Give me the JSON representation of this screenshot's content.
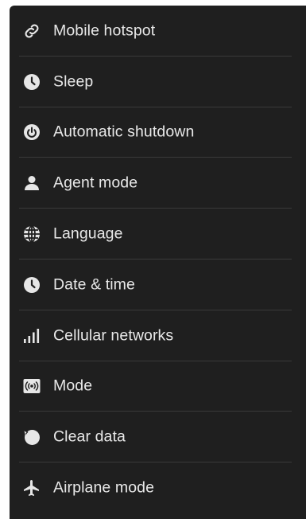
{
  "menu": {
    "items": [
      {
        "label": "Mobile hotspot",
        "icon": "link-icon"
      },
      {
        "label": "Sleep",
        "icon": "clock-icon"
      },
      {
        "label": "Automatic shutdown",
        "icon": "power-icon"
      },
      {
        "label": "Agent mode",
        "icon": "person-icon"
      },
      {
        "label": "Language",
        "icon": "globe-icon"
      },
      {
        "label": "Date & time",
        "icon": "clock-icon"
      },
      {
        "label": "Cellular networks",
        "icon": "signal-bars-icon"
      },
      {
        "label": "Mode",
        "icon": "broadcast-icon"
      },
      {
        "label": "Clear data",
        "icon": "restore-icon"
      },
      {
        "label": "Airplane mode",
        "icon": "airplane-icon"
      }
    ]
  },
  "colors": {
    "panel_background": "#1f1f1f",
    "text": "#e8e8e8",
    "divider": "#3a3a3a",
    "icon": "#e6e6e6"
  }
}
